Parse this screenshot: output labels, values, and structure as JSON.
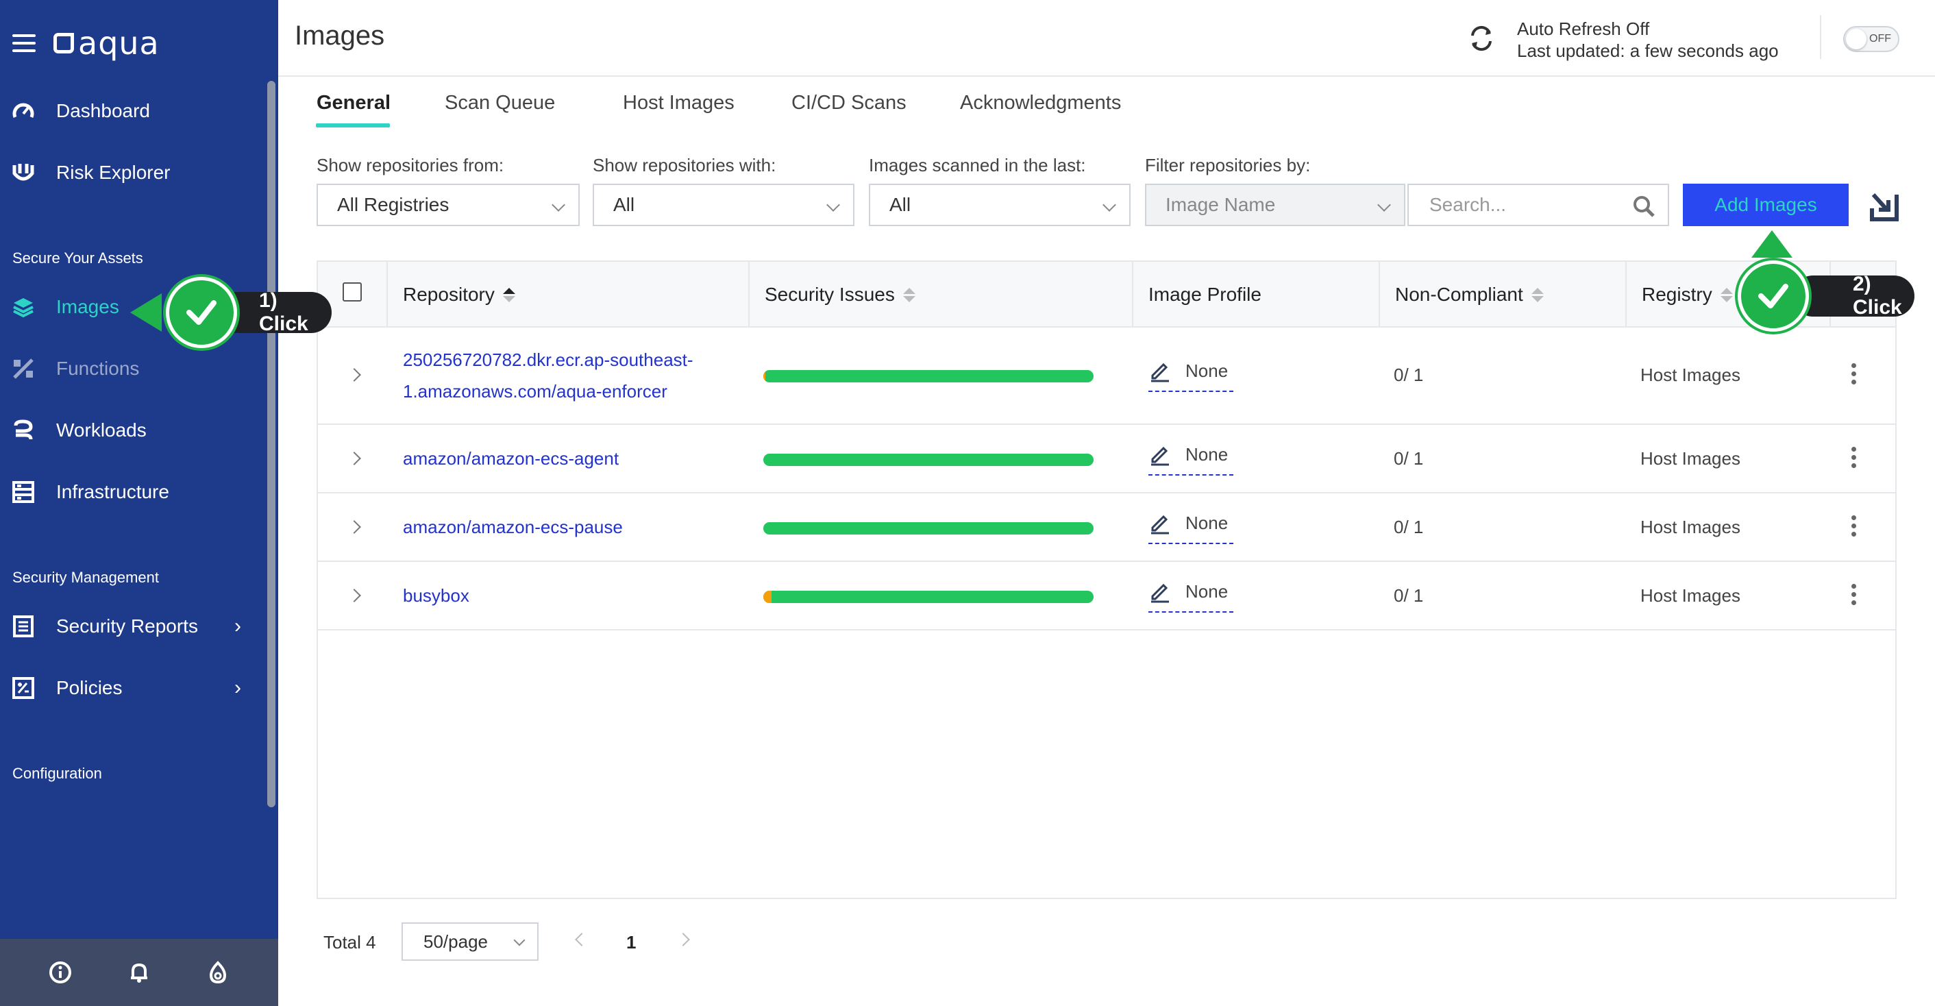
{
  "sidebar": {
    "logo": "aqua",
    "nav": [
      {
        "label": "Dashboard",
        "icon": "speedometer-icon"
      },
      {
        "label": "Risk Explorer",
        "icon": "risk-explorer-icon"
      }
    ],
    "section_assets": "Secure Your Assets",
    "assets": [
      {
        "label": "Images",
        "icon": "layers-icon",
        "active": true
      },
      {
        "label": "Functions",
        "icon": "functions-icon",
        "dim": true
      },
      {
        "label": "Workloads",
        "icon": "workloads-icon"
      },
      {
        "label": "Infrastructure",
        "icon": "infrastructure-icon"
      }
    ],
    "section_management": "Security Management",
    "management": [
      {
        "label": "Security Reports",
        "icon": "report-icon"
      },
      {
        "label": "Policies",
        "icon": "policies-icon"
      }
    ],
    "section_configuration": "Configuration",
    "footer_icons": [
      "info-icon",
      "bell-icon",
      "help-flame-icon"
    ]
  },
  "header": {
    "title": "Images",
    "refresh_status": "Auto Refresh Off",
    "last_updated": "Last updated: a few seconds ago",
    "toggle_label": "OFF"
  },
  "tabs": [
    "General",
    "Scan Queue",
    "Host Images",
    "CI/CD Scans",
    "Acknowledgments"
  ],
  "filters": {
    "registries_label": "Show repositories from:",
    "registries_value": "All Registries",
    "with_label": "Show repositories with:",
    "with_value": "All",
    "scanned_label": "Images scanned in the last:",
    "scanned_value": "All",
    "filter_label": "Filter repositories by:",
    "filter_value": "Image Name",
    "search_placeholder": "Search...",
    "add_button": "Add Images"
  },
  "table": {
    "columns": [
      "Repository",
      "Security Issues",
      "Image Profile",
      "Non-Compliant",
      "Registry"
    ],
    "rows": [
      {
        "repo_line1": "250256720782.dkr.ecr.ap-southeast-",
        "repo_line2": "1.amazonaws.com/aqua-enforcer",
        "issues_fraction_orange": 0.006,
        "profile": "None",
        "noncompliant": "0/ 1",
        "registry": "Host Images"
      },
      {
        "repo_line1": "amazon/amazon-ecs-agent",
        "repo_line2": "",
        "issues_fraction_orange": 0,
        "profile": "None",
        "noncompliant": "0/ 1",
        "registry": "Host Images"
      },
      {
        "repo_line1": "amazon/amazon-ecs-pause",
        "repo_line2": "",
        "issues_fraction_orange": 0,
        "profile": "None",
        "noncompliant": "0/ 1",
        "registry": "Host Images"
      },
      {
        "repo_line1": "busybox",
        "repo_line2": "",
        "issues_fraction_orange": 0.025,
        "profile": "None",
        "noncompliant": "0/ 1",
        "registry": "Host Images"
      }
    ]
  },
  "pagination": {
    "total": "Total 4",
    "page_size": "50/page",
    "current_page": "1"
  },
  "annotations": [
    {
      "text": "1) Click"
    },
    {
      "text": "2) Click"
    }
  ],
  "colors": {
    "sidebar_bg": "#1e3a8a",
    "accent_teal": "#2dd4c5",
    "add_button_bg": "#2948f2",
    "link_blue": "#2233cc",
    "ok_green": "#22c55e",
    "annotation_green": "#1fb24a"
  }
}
